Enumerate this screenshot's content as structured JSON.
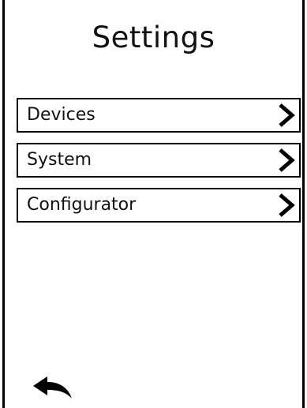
{
  "header": {
    "title": "Settings"
  },
  "menu": {
    "items": [
      {
        "label": "Devices",
        "icon": "chevron-right-icon"
      },
      {
        "label": "System",
        "icon": "chevron-right-icon"
      },
      {
        "label": "Configurator",
        "icon": "chevron-right-icon"
      }
    ]
  },
  "footer": {
    "back_icon": "back-arrow-icon"
  },
  "colors": {
    "foreground": "#000000",
    "background": "#ffffff"
  }
}
